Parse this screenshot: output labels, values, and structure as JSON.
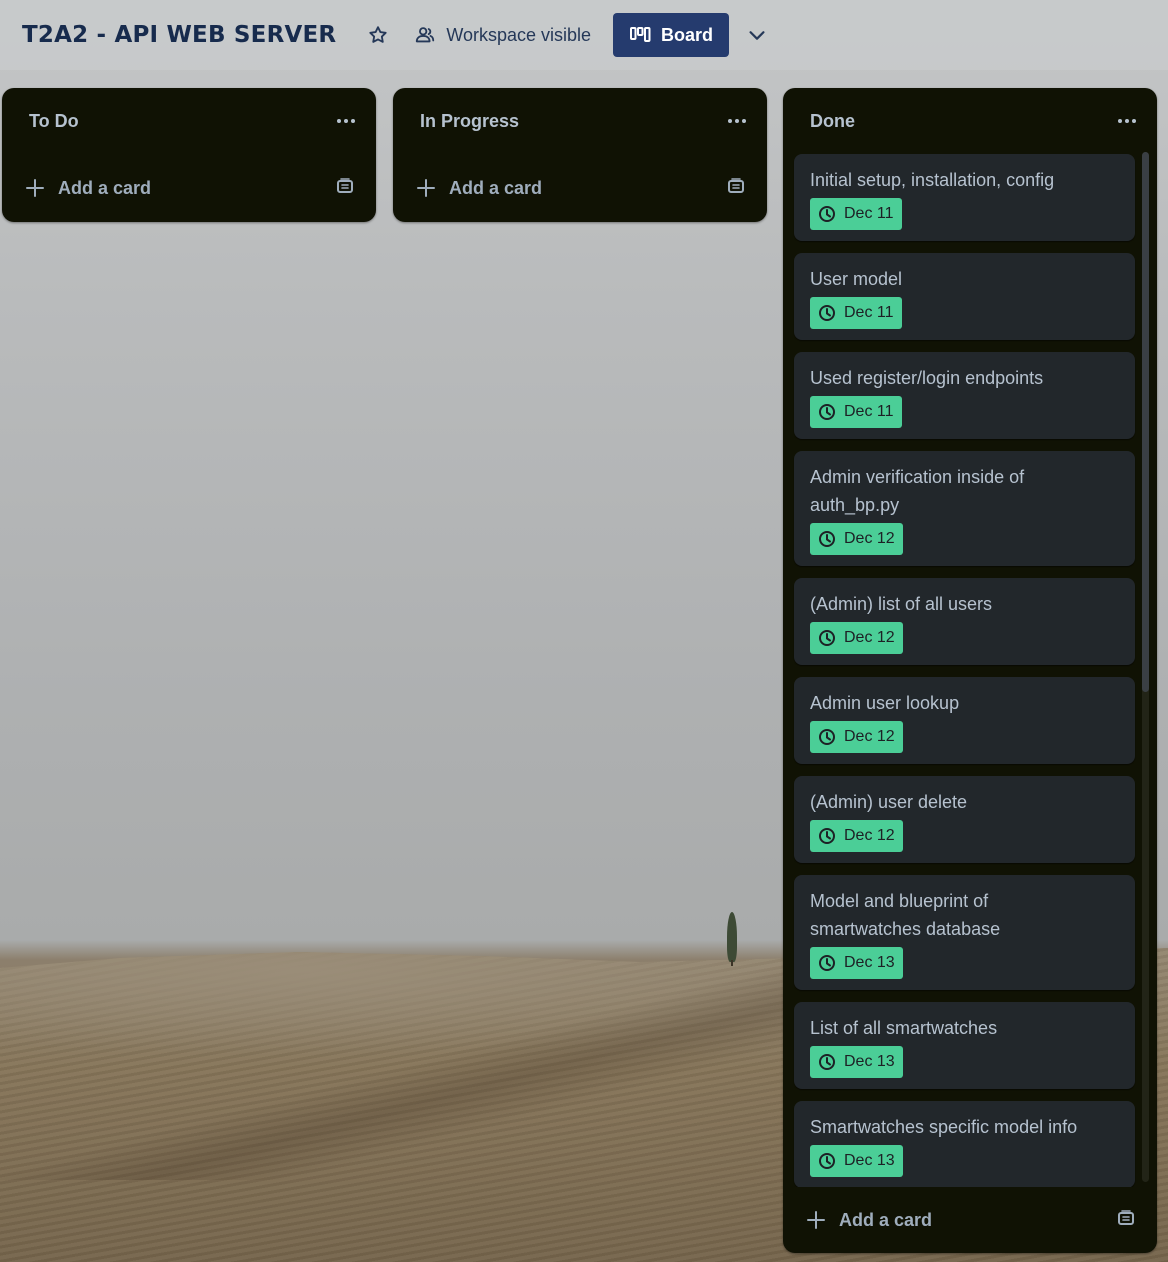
{
  "header": {
    "board_title": "T2A2 - API WEB SERVER",
    "visibility_label": "Workspace visible",
    "view_label": "Board"
  },
  "lists": [
    {
      "title": "To Do",
      "add_card_label": "Add a card",
      "cards": []
    },
    {
      "title": "In Progress",
      "add_card_label": "Add a card",
      "cards": []
    },
    {
      "title": "Done",
      "add_card_label": "Add a card",
      "cards": [
        {
          "title": "Initial setup, installation, config",
          "due": "Dec 11"
        },
        {
          "title": "User model",
          "due": "Dec 11"
        },
        {
          "title": "Used register/login endpoints",
          "due": "Dec 11"
        },
        {
          "title": "Admin verification inside of auth_bp.py",
          "due": "Dec 12"
        },
        {
          "title": "(Admin) list of all users",
          "due": "Dec 12"
        },
        {
          "title": "Admin user lookup",
          "due": "Dec 12"
        },
        {
          "title": "(Admin) user delete",
          "due": "Dec 12"
        },
        {
          "title": "Model and blueprint of smartwatches database",
          "due": "Dec 13"
        },
        {
          "title": "List of all smartwatches",
          "due": "Dec 13"
        },
        {
          "title": "Smartwatches specific model info",
          "due": "Dec 13"
        }
      ]
    }
  ],
  "colors": {
    "list_bg": "#101204",
    "card_bg": "#22272b",
    "due_complete": "#4bce97",
    "board_button": "#253b6e",
    "title_text": "#172b4d"
  },
  "icons": [
    "star-icon",
    "workspace-icon",
    "board-icon",
    "chevron-down-icon",
    "ellipsis-icon",
    "plus-icon",
    "template-icon",
    "clock-icon"
  ]
}
